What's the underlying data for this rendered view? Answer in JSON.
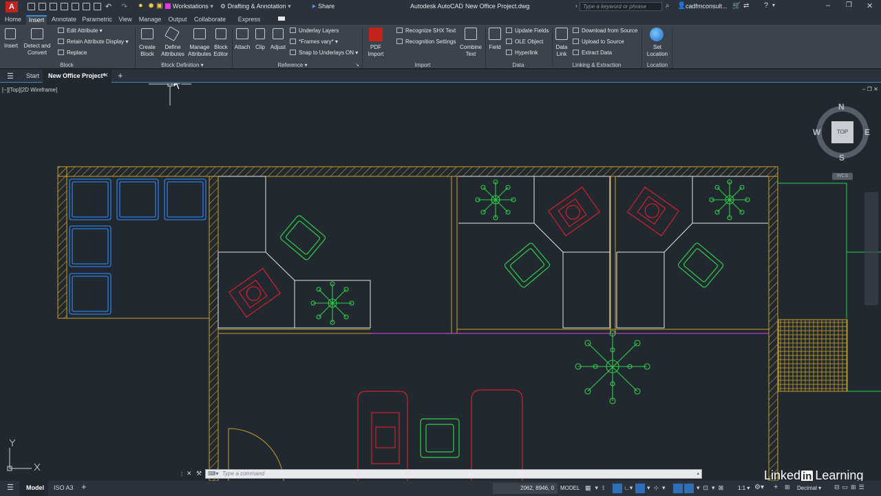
{
  "titlebar": {
    "app_letter": "A",
    "workspace": "Workstations",
    "workspace_mode": "Drafting & Annotation",
    "share": "Share",
    "app_name": "Autodesk AutoCAD",
    "file_name": "New Office Project.dwg",
    "search_placeholder": "Type a keyword or phrase",
    "user": "cadfmconsult..."
  },
  "menu_tabs": [
    "Home",
    "Insert",
    "Annotate",
    "Parametric",
    "View",
    "Manage",
    "Output",
    "Collaborate",
    "Express Tools"
  ],
  "ribbon": {
    "block": {
      "insert": "Insert",
      "detect": "Detect and",
      "convert": "Convert",
      "edit_attribute": "Edit Attribute",
      "retain_display": "Retain Attribute Display",
      "replace": "Replace",
      "panel": "Block"
    },
    "block_definition": {
      "create": "Create",
      "create2": "Block",
      "define": "Define",
      "define2": "Attributes",
      "manage": "Manage",
      "manage2": "Attributes",
      "editor": "Block",
      "editor2": "Editor",
      "panel": "Block Definition"
    },
    "reference": {
      "attach": "Attach",
      "clip": "Clip",
      "adjust": "Adjust",
      "underlay_layers": "Underlay Layers",
      "frames_vary": "*Frames vary*",
      "snap_underlays": "Snap to Underlays ON",
      "panel": "Reference"
    },
    "import": {
      "pdf": "PDF",
      "pdf2": "Import",
      "recognize": "Recognize SHX Text",
      "settings": "Recognition Settings",
      "combine": "Combine",
      "combine2": "Text",
      "panel": "Import"
    },
    "data": {
      "field": "Field",
      "update_fields": "Update Fields",
      "ole": "OLE Object",
      "hyperlink": "Hyperlink",
      "panel": "Data"
    },
    "linking": {
      "data_link": "Data",
      "data_link2": "Link",
      "download": "Download from Source",
      "upload": "Upload to Source",
      "extract": "Extract  Data",
      "panel": "Linking & Extraction"
    },
    "location": {
      "set": "Set",
      "set2": "Location",
      "panel": "Location"
    }
  },
  "doc_tabs": {
    "start": "Start",
    "active": "New Office Project*"
  },
  "viewport": {
    "label": "[−][Top][2D Wireframe]",
    "compass": {
      "n": "N",
      "s": "S",
      "e": "E",
      "w": "W",
      "top": "TOP",
      "wcs": "WCS"
    }
  },
  "command": {
    "placeholder": "Type  a  command"
  },
  "status": {
    "model_tab": "Model",
    "layout_tab": "ISO A3",
    "coords": "2062, 8946, 0",
    "mode": "MODEL",
    "scale": "1:1",
    "units": "Decimal"
  },
  "watermark": {
    "part1": "Linked",
    "part2": "in",
    "part3": "Learning"
  },
  "colors": {
    "wall": "#c9a227",
    "furniture_white": "#e6e6e6",
    "chair_green": "#2fd14a",
    "desk_red": "#d3212b",
    "sofa_blue": "#2f7fe0",
    "accent": "#3c89d0"
  }
}
